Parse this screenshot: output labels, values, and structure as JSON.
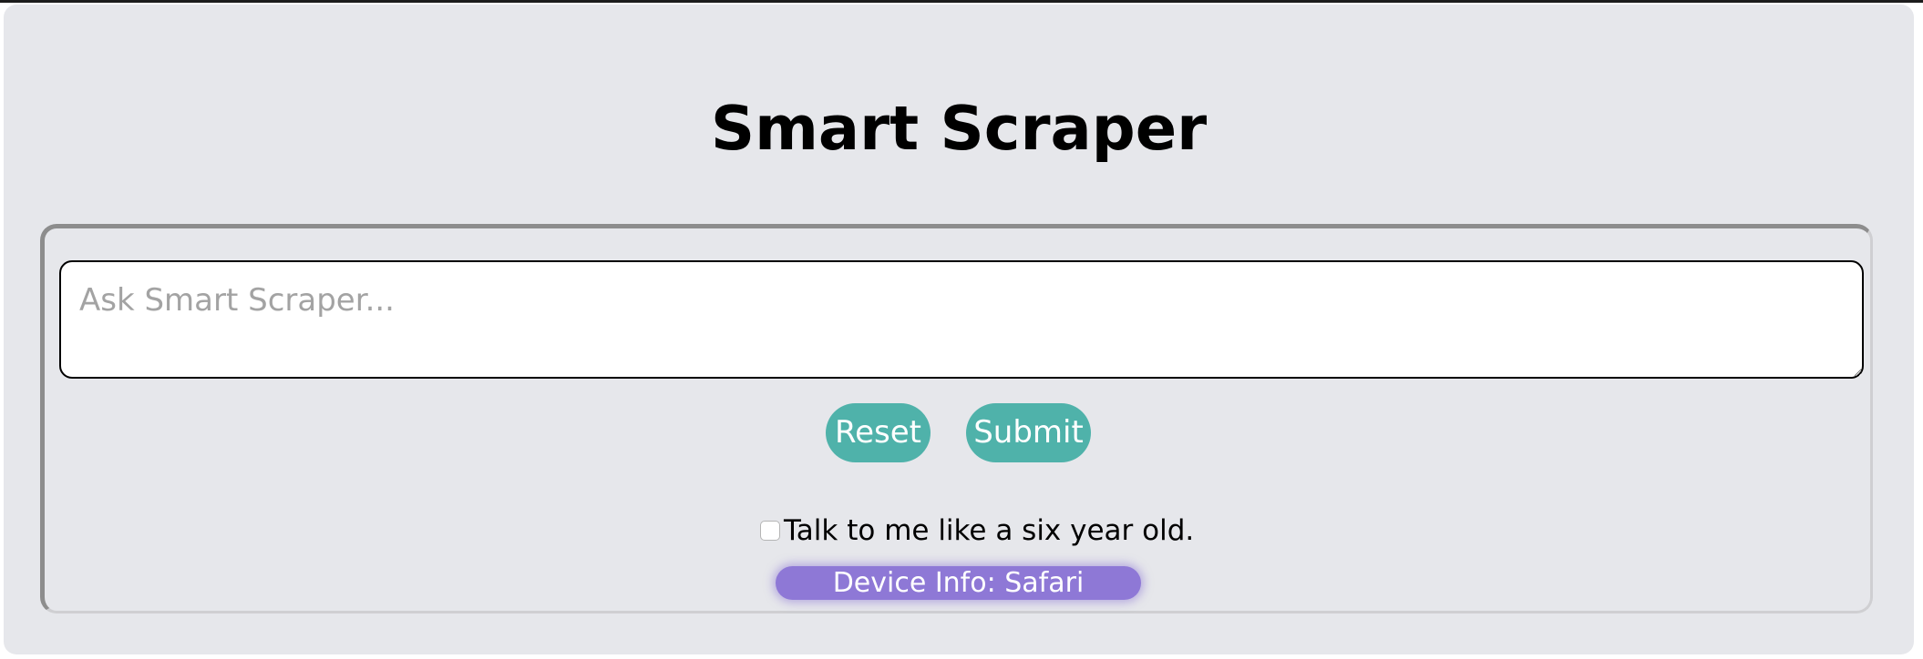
{
  "app": {
    "title": "Smart Scraper"
  },
  "query": {
    "placeholder": "Ask Smart Scraper...",
    "value": ""
  },
  "buttons": {
    "reset_label": "Reset",
    "submit_label": "Submit"
  },
  "options": {
    "six_year_old_label": "Talk to me like a six year old.",
    "six_year_old_checked": false
  },
  "device": {
    "info_label": "Device Info: Safari"
  },
  "colors": {
    "background": "#e6e7eb",
    "button": "#4fb2aa",
    "device_pill": "#8e78d6",
    "text": "#000000"
  }
}
